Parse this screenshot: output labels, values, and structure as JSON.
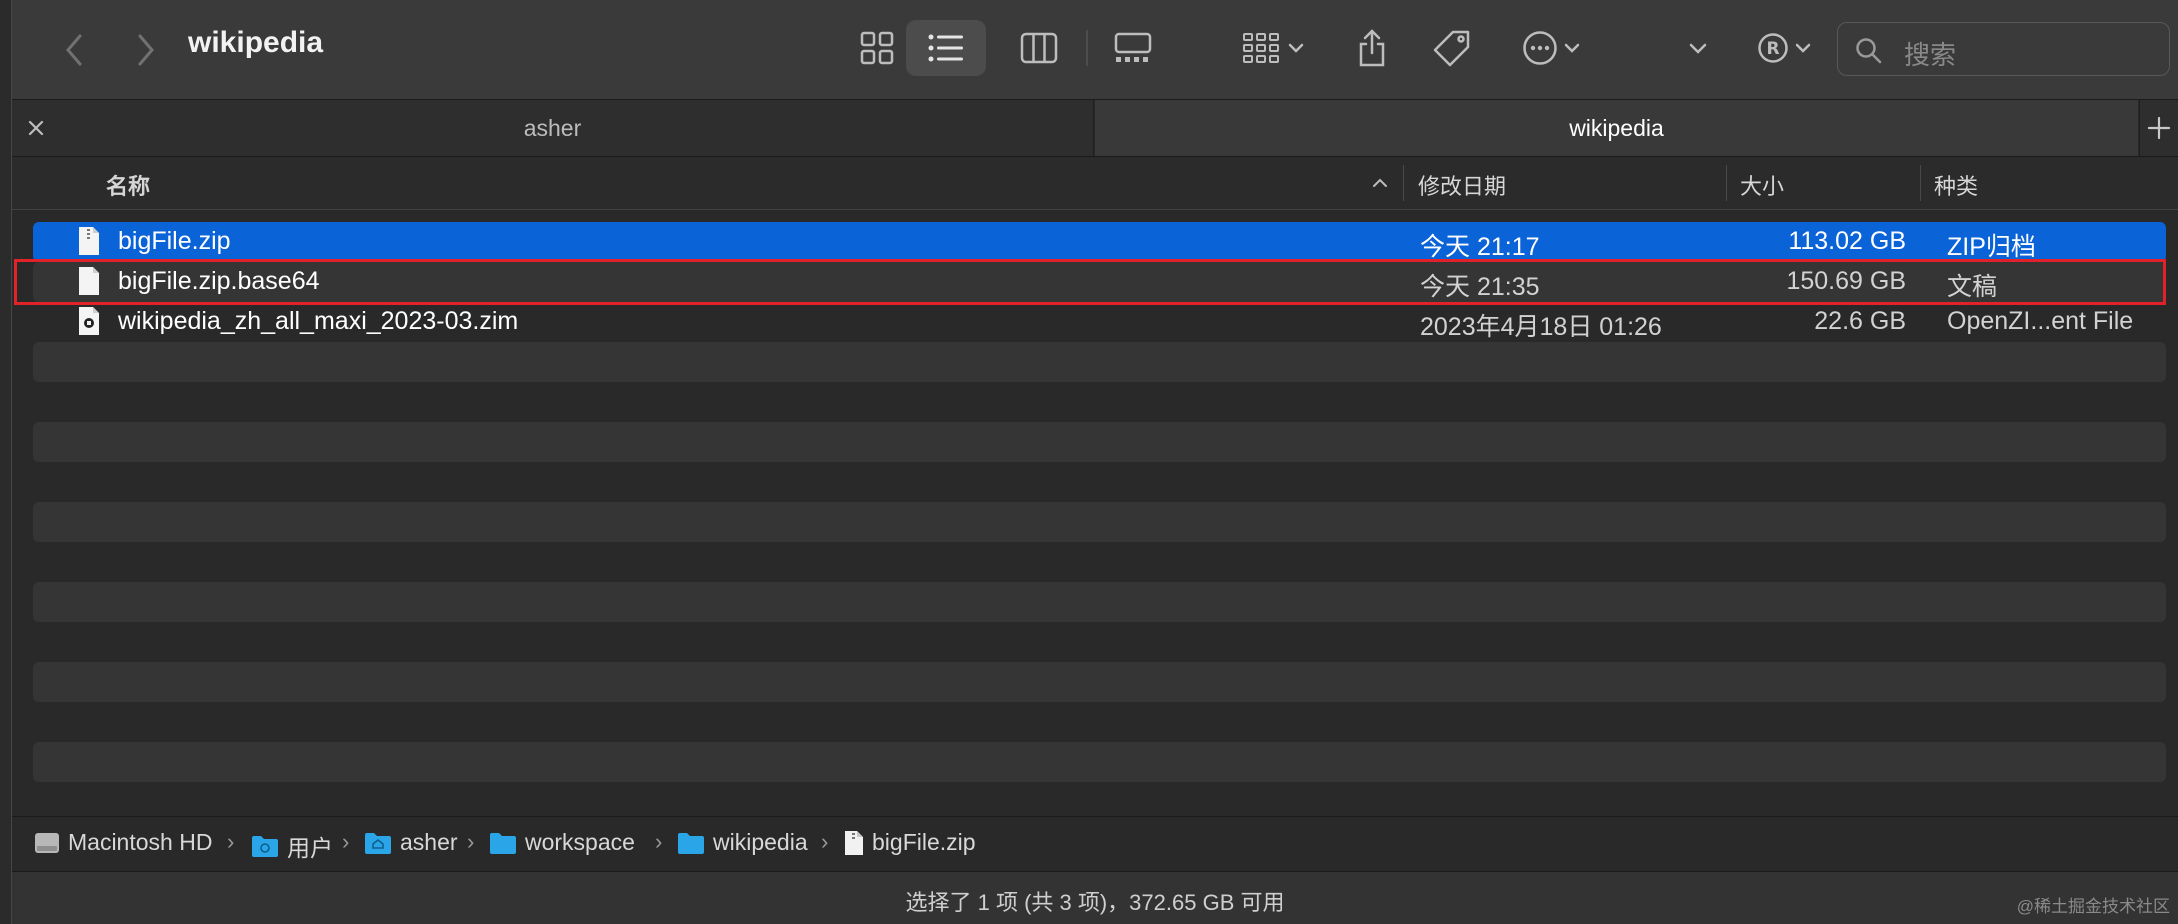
{
  "window": {
    "title": "wikipedia"
  },
  "toolbar": {
    "back_icon": "chevron-left-icon",
    "forward_icon": "chevron-right-icon",
    "views": [
      "icon-view",
      "list-view",
      "column-view",
      "gallery-view"
    ],
    "selected_view": "list-view",
    "search_placeholder": "搜索"
  },
  "tabs": [
    {
      "label": "asher",
      "active": false
    },
    {
      "label": "wikipedia",
      "active": true
    }
  ],
  "columns": {
    "name": "名称",
    "date": "修改日期",
    "size": "大小",
    "kind": "种类"
  },
  "files": [
    {
      "name": "bigFile.zip",
      "date": "今天 21:17",
      "size": "113.02 GB",
      "kind": "ZIP归档",
      "selected": true,
      "icon": "zip-file-icon"
    },
    {
      "name": "bigFile.zip.base64",
      "date": "今天 21:35",
      "size": "150.69 GB",
      "kind": "文稿",
      "selected": false,
      "highlighted": true,
      "icon": "document-file-icon"
    },
    {
      "name": "wikipedia_zh_all_maxi_2023-03.zim",
      "date": "2023年4月18日 01:26",
      "size": "22.6 GB",
      "kind": "OpenZI...ent File",
      "selected": false,
      "icon": "zim-file-icon"
    }
  ],
  "path": [
    {
      "label": "Macintosh HD",
      "icon": "hard-drive-icon"
    },
    {
      "label": "用户",
      "icon": "folder-icon"
    },
    {
      "label": "asher",
      "icon": "home-folder-icon"
    },
    {
      "label": "workspace",
      "icon": "folder-icon"
    },
    {
      "label": "wikipedia",
      "icon": "folder-icon"
    },
    {
      "label": "bigFile.zip",
      "icon": "file-icon"
    }
  ],
  "status": {
    "text": "选择了 1 项 (共 3 项)，372.65 GB 可用"
  },
  "watermark": "@稀土掘金技术社区",
  "colors": {
    "selection": "#0b63d8",
    "highlight_border": "#e1222b",
    "folder": "#2aa6e8"
  }
}
